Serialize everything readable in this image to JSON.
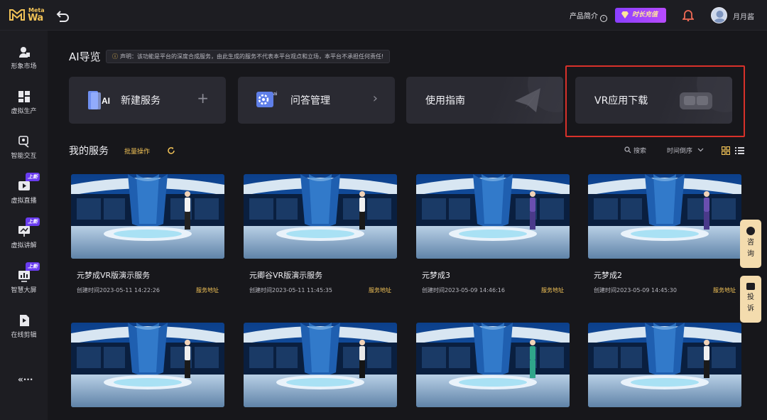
{
  "brand": {
    "line1": "Meta",
    "line2": "Wa"
  },
  "header": {
    "intro_label": "产品简介",
    "recharge_label": "时长充值",
    "username": "月月酱"
  },
  "sidebar": {
    "items": [
      {
        "label": "形象市场",
        "icon": "person-icon",
        "badge": ""
      },
      {
        "label": "虚拟生产",
        "icon": "grid-icon",
        "badge": ""
      },
      {
        "label": "智能交互",
        "icon": "chat-icon",
        "badge": ""
      },
      {
        "label": "虚拟直播",
        "icon": "play-icon",
        "badge": "上新"
      },
      {
        "label": "虚拟讲解",
        "icon": "presentation-icon",
        "badge": "上新"
      },
      {
        "label": "智慧大屏",
        "icon": "screen-icon",
        "badge": "上新"
      },
      {
        "label": "在线剪辑",
        "icon": "edit-icon",
        "badge": ""
      }
    ],
    "collapse_label": "«···"
  },
  "guide": {
    "title": "AI导览",
    "notice": "声明：该功能是平台的深度合成服务，由此生成的服务不代表本平台观点和立场，本平台不承担任何责任!"
  },
  "cards": [
    {
      "title": "新建服务",
      "icon": "ai-icon",
      "action": "+"
    },
    {
      "title": "问答管理",
      "icon": "gear-ai-icon",
      "action": "›"
    },
    {
      "title": "使用指南",
      "icon": "paper-plane-icon",
      "action": ""
    },
    {
      "title": "VR应用下载",
      "icon": "vr-headset-icon",
      "action": ""
    }
  ],
  "services": {
    "title": "我的服务",
    "batch_label": "批量操作",
    "search_label": "搜索",
    "sort_label": "时间倒序",
    "link_label": "服务地址",
    "items": [
      {
        "name": "元梦成VR版演示服务",
        "date": "创建时间2023-05-11 14:22:26",
        "figure": "white-shirt"
      },
      {
        "name": "元卿谷VR版演示服务",
        "date": "创建时间2023-05-11 11:45:35",
        "figure": "woman-suit"
      },
      {
        "name": "元梦成3",
        "date": "创建时间2023-05-09 14:46:16",
        "figure": "purple-suit"
      },
      {
        "name": "元梦成2",
        "date": "创建时间2023-05-09 14:45:30",
        "figure": "purple-suit"
      },
      {
        "name": "",
        "date": "",
        "figure": "woman-suit"
      },
      {
        "name": "",
        "date": "",
        "figure": "man-suit"
      },
      {
        "name": "",
        "date": "",
        "figure": "green-dress"
      },
      {
        "name": "",
        "date": "",
        "figure": "woman-suit"
      }
    ]
  },
  "float": {
    "consult": [
      "咨",
      "询"
    ],
    "complain": [
      "投",
      "诉"
    ]
  },
  "colors": {
    "accent": "#f1c257",
    "purple": "#8a3fff",
    "highlight": "#d8312a"
  }
}
